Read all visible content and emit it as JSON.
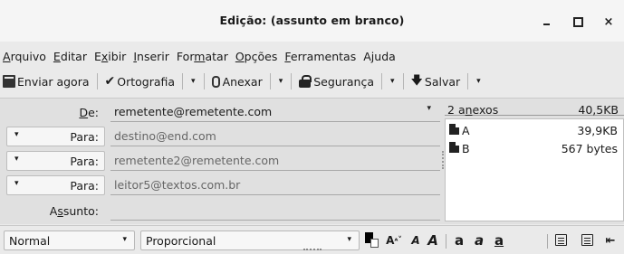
{
  "window": {
    "title": "Edição: (assunto em branco)",
    "minimize_icon": "minimize-icon",
    "maximize_icon": "maximize-icon",
    "close_glyph": "×"
  },
  "menu": [
    {
      "label": "Arquivo",
      "accel_index": 0
    },
    {
      "label": "Editar",
      "accel_index": 0
    },
    {
      "label": "Exibir",
      "accel_index": 1
    },
    {
      "label": "Inserir",
      "accel_index": 0
    },
    {
      "label": "Formatar",
      "accel_index": 3
    },
    {
      "label": "Opções",
      "accel_index": 0
    },
    {
      "label": "Ferramentas",
      "accel_index": 0
    },
    {
      "label": "Ajuda",
      "accel_index": 1
    }
  ],
  "toolbar": {
    "send_label": "Enviar agora",
    "spelling_label": "Ortografia",
    "attach_label": "Anexar",
    "security_label": "Segurança",
    "save_label": "Salvar",
    "dropdown_glyph": "▾"
  },
  "header": {
    "from_label": "De:",
    "from_accel_index": 0,
    "from_value": "remetente@remetente.com",
    "recipients": [
      {
        "type": "Para:",
        "address": "destino@end.com"
      },
      {
        "type": "Para:",
        "address": "remetente2@remetente.com"
      },
      {
        "type": "Para:",
        "address": "leitor5@textos.com.br"
      }
    ],
    "subject_label": "Assunto:",
    "subject_accel_index": 1,
    "subject_value": ""
  },
  "attachments": {
    "count_label": "2 anexos",
    "count_accel_index": 3,
    "total_size": "40,5KB",
    "items": [
      {
        "name": "A",
        "size": "39,9KB"
      },
      {
        "name": "B",
        "size": "567 bytes"
      }
    ]
  },
  "format": {
    "paragraph_style": "Normal",
    "font": "Proporcional",
    "icons": [
      "text-color-icon",
      "font-size-icon",
      "smaller-text-icon",
      "larger-text-icon",
      "bold-icon",
      "italic-icon",
      "underline-icon",
      "bulleted-list-icon",
      "numbered-list-icon",
      "outdent-icon"
    ]
  },
  "colors": {
    "title_bg": "#f5f5f5",
    "window_bg": "#eaeaea",
    "header_bg": "#e0e0e0",
    "field_text_muted": "#666666"
  }
}
